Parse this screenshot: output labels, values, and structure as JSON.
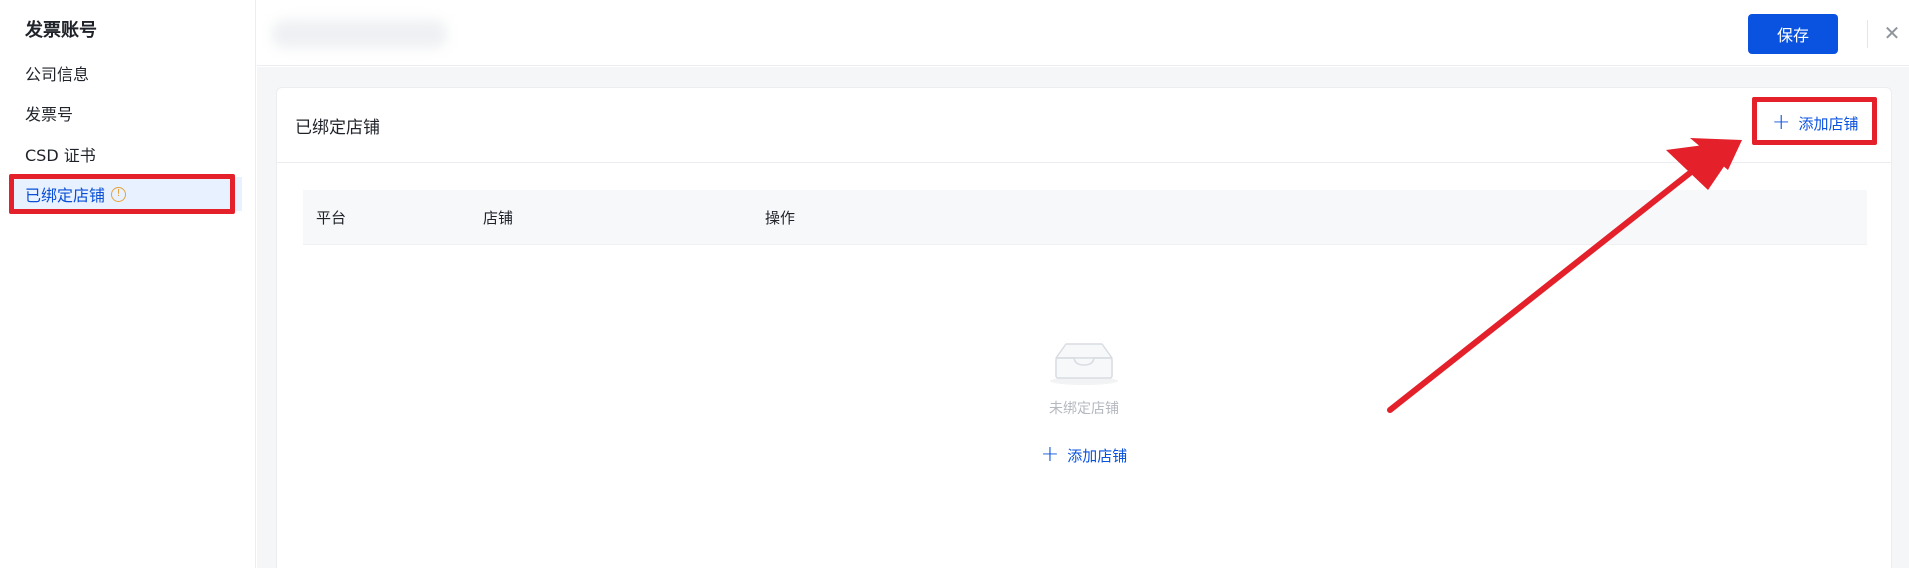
{
  "sidebar": {
    "title": "发票账号",
    "items": [
      {
        "label": "公司信息",
        "active": false
      },
      {
        "label": "发票号",
        "active": false
      },
      {
        "label": "CSD 证书",
        "active": false
      },
      {
        "label": "已绑定店铺",
        "active": true
      }
    ],
    "info_glyph": "!"
  },
  "topbar": {
    "save_label": "保存",
    "close_glyph": "✕"
  },
  "card": {
    "title": "已绑定店铺",
    "add_store_label": "添加店铺",
    "plus_glyph": "+",
    "table": {
      "columns": [
        "平台",
        "店铺",
        "操作"
      ],
      "rows": []
    },
    "empty": {
      "text": "未绑定店铺",
      "add_label": "添加店铺"
    }
  },
  "colors": {
    "accent": "#0a52e0",
    "annotation_red": "#e4202a",
    "active_bg": "#e8f1ff",
    "warning": "#e6a23c"
  },
  "icons": {
    "info": "info-circle-icon",
    "close": "close-icon",
    "plus": "plus-icon",
    "empty": "empty-inbox-icon"
  }
}
